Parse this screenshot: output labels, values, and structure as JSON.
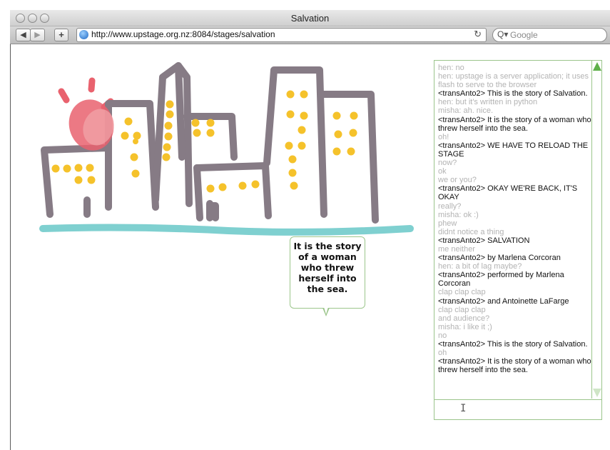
{
  "window": {
    "title": "Salvation"
  },
  "toolbar": {
    "back_icon": "back-arrow-icon",
    "forward_icon": "forward-arrow-icon",
    "add_bookmark_label": "+",
    "url": "http://www.upstage.org.nz:8084/stages/salvation",
    "search_placeholder": "Google"
  },
  "stage": {
    "bubble_text": "It is the story of a woman who threw herself into the sea.",
    "colors": {
      "building": "#867b85",
      "window": "#f5c22b",
      "sun": "#e9626e",
      "sea": "#7fd0d0"
    }
  },
  "chat": {
    "messages": [
      {
        "text": "hen: no",
        "kind": "audience"
      },
      {
        "text": "hen: upstage is a server application; it uses flash to serve to the browser",
        "kind": "audience"
      },
      {
        "text": "<transAnto2> This is the story of Salvation.",
        "kind": "player"
      },
      {
        "text": "hen: but it's written in python",
        "kind": "audience"
      },
      {
        "text": "misha: ah.  nice.",
        "kind": "audience"
      },
      {
        "text": "<transAnto2> It is the story of a woman who threw herself into the sea.",
        "kind": "player"
      },
      {
        "text": "oh!",
        "kind": "audience"
      },
      {
        "text": "<transAnto2> WE  HAVE TO RELOAD THE STAGE",
        "kind": "player"
      },
      {
        "text": "now?",
        "kind": "audience"
      },
      {
        "text": "ok",
        "kind": "audience"
      },
      {
        "text": "we or you?",
        "kind": "audience"
      },
      {
        "text": "<transAnto2> OKAY WE'RE BACK, IT'S OKAY",
        "kind": "player"
      },
      {
        "text": "really?",
        "kind": "audience"
      },
      {
        "text": "misha: ok :)",
        "kind": "audience"
      },
      {
        "text": "phew",
        "kind": "audience"
      },
      {
        "text": "didnt notice a thing",
        "kind": "audience"
      },
      {
        "text": "<transAnto2> SALVATION",
        "kind": "player"
      },
      {
        "text": "me neither",
        "kind": "audience"
      },
      {
        "text": "<transAnto2> by Marlena Corcoran",
        "kind": "player"
      },
      {
        "text": "hen: a bit of lag maybe?",
        "kind": "audience"
      },
      {
        "text": "<transAnto2> performed by Marlena Corcoran",
        "kind": "player"
      },
      {
        "text": "clap clap clap",
        "kind": "audience"
      },
      {
        "text": "<transAnto2> and Antoinette LaFarge",
        "kind": "player"
      },
      {
        "text": "clap clap clap",
        "kind": "audience"
      },
      {
        "text": "and audience?",
        "kind": "audience"
      },
      {
        "text": "misha: i like it ;)",
        "kind": "audience"
      },
      {
        "text": "no",
        "kind": "audience"
      },
      {
        "text": "<transAnto2> This is the story of Salvation.",
        "kind": "player"
      },
      {
        "text": "oh",
        "kind": "audience"
      },
      {
        "text": "<transAnto2> It is the story of a woman who threw herself into the sea.",
        "kind": "player"
      }
    ],
    "colors": {
      "audience": "#b3b3b3",
      "player": "#111111",
      "border": "#9bc58b"
    }
  }
}
